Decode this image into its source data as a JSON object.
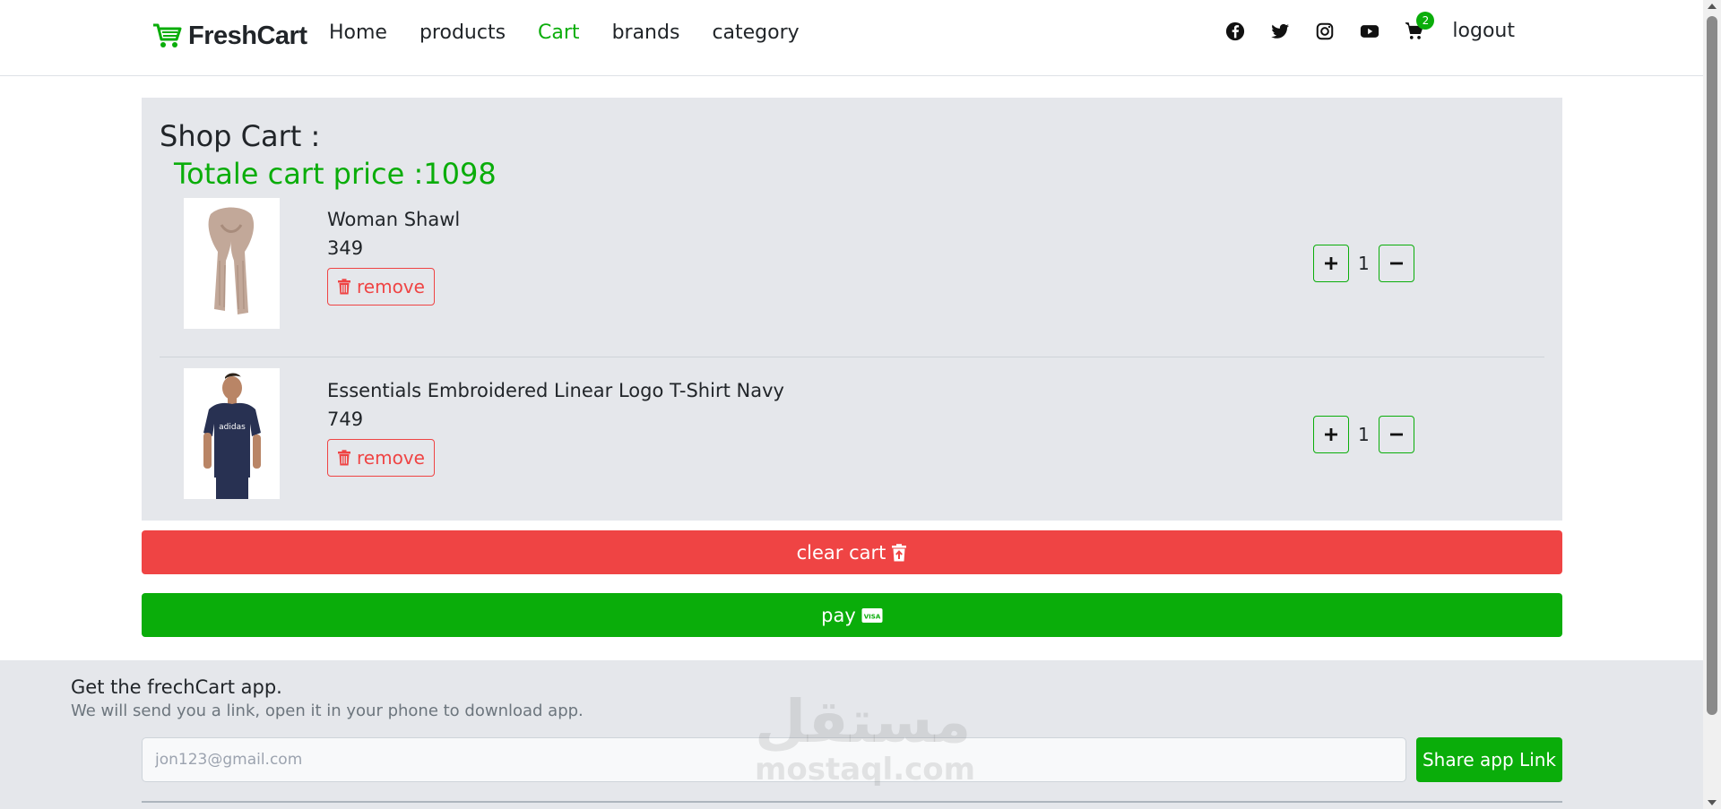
{
  "navbar": {
    "brand": "FreshCart",
    "links": [
      "Home",
      "products",
      "Cart",
      "brands",
      "category"
    ],
    "active_link": "Cart",
    "social_icons": [
      "facebook-icon",
      "twitter-icon",
      "instagram-icon",
      "youtube-icon"
    ],
    "cart_count": "2",
    "logout": "logout"
  },
  "cart": {
    "title": "Shop Cart :",
    "total_label": "Totale cart price :1098",
    "items": [
      {
        "name": "Woman Shawl",
        "price": "349",
        "quantity": "1",
        "remove_label": "remove"
      },
      {
        "name": "Essentials Embroidered Linear Logo T-Shirt Navy",
        "price": "749",
        "quantity": "1",
        "remove_label": "remove"
      }
    ]
  },
  "buttons": {
    "clear_cart": "clear cart",
    "pay": "pay"
  },
  "footer": {
    "title": "Get the frechCart app.",
    "subtitle": "We will send you a link, open it in your phone to download app.",
    "email_placeholder": "jon123@gmail.com",
    "share_button": "Share app Link"
  },
  "watermark": {
    "arabic": "مستقل",
    "latin": "mostaql.com"
  },
  "colors": {
    "accent": "#0aad0a",
    "danger": "#ef4444",
    "panel": "#e5e7eb"
  }
}
